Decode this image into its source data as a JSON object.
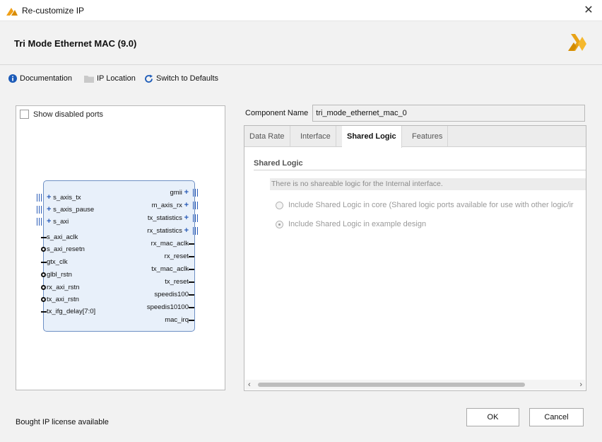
{
  "window": {
    "title": "Re-customize IP",
    "close_glyph": "✕"
  },
  "header": {
    "title": "Tri Mode Ethernet MAC (9.0)"
  },
  "toolbar": {
    "documentation": "Documentation",
    "ip_location": "IP Location",
    "switch_defaults": "Switch to Defaults"
  },
  "left_panel": {
    "show_disabled_ports": "Show disabled ports",
    "left_ports": [
      "s_axis_tx",
      "s_axis_pause",
      "s_axi",
      "s_axi_aclk",
      "s_axi_resetn",
      "gtx_clk",
      "glbl_rstn",
      "rx_axi_rstn",
      "tx_axi_rstn",
      "tx_ifg_delay[7:0]"
    ],
    "right_ports": [
      "gmii",
      "m_axis_rx",
      "tx_statistics",
      "rx_statistics",
      "rx_mac_aclk",
      "rx_reset",
      "tx_mac_aclk",
      "tx_reset",
      "speedis100",
      "speedis10100",
      "mac_irq"
    ],
    "plus_glyph": "+"
  },
  "component": {
    "label": "Component Name",
    "value": "tri_mode_ethernet_mac_0"
  },
  "tabs": [
    "Data Rate",
    "Interface",
    "Shared Logic",
    "Features"
  ],
  "shared_logic": {
    "section": "Shared Logic",
    "info": "There is no shareable logic for the Internal interface.",
    "option_core": "Include Shared Logic in core (Shared logic ports available for use with other logic/ir",
    "option_example": "Include Shared Logic in example design",
    "selected": "option_example"
  },
  "scroll": {
    "left_arrow": "‹",
    "right_arrow": "›"
  },
  "footer": {
    "license": "Bought IP license available",
    "ok": "OK",
    "cancel": "Cancel"
  },
  "colors": {
    "xilinx_logo": "#f0a018",
    "port_plus": "#2a5cb8",
    "block_fill": "#e8f0fa"
  },
  "icons": {
    "documentation": "info-icon",
    "ip_location": "folder-icon",
    "switch_defaults": "refresh-icon"
  }
}
